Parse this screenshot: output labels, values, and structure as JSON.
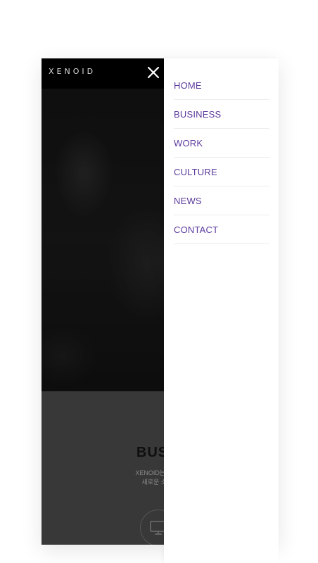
{
  "header": {
    "logo_text": "XENOID"
  },
  "section": {
    "title": "BUSIN",
    "desc_line1": "XENOID는 기술과",
    "desc_line2": "새로운 소통을"
  },
  "menu": {
    "items": [
      {
        "label": "HOME"
      },
      {
        "label": "BUSINESS"
      },
      {
        "label": "WORK"
      },
      {
        "label": "CULTURE"
      },
      {
        "label": "NEWS"
      },
      {
        "label": "CONTACT"
      }
    ]
  },
  "colors": {
    "menu_text": "#5b3a9e",
    "topbar": "#000000",
    "divider": "#ececec"
  },
  "icons": {
    "close": "close-icon",
    "section": "monitor-icon"
  }
}
